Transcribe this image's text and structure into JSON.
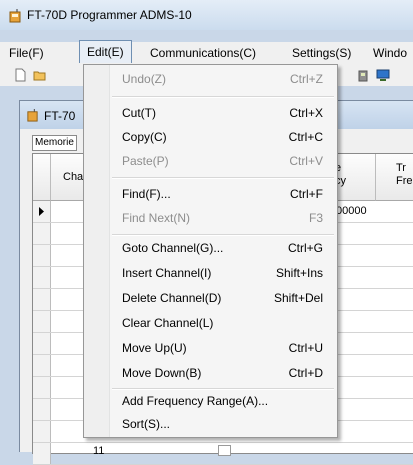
{
  "window": {
    "title": "FT-70D Programmer ADMS-10"
  },
  "menubar": {
    "items": [
      {
        "label": "File(F)"
      },
      {
        "label": "Edit(E)"
      },
      {
        "label": "Communications(C)"
      },
      {
        "label": "Settings(S)"
      },
      {
        "label": "Windo"
      }
    ]
  },
  "child": {
    "title": "FT-70",
    "tab": "Memorie",
    "grid": {
      "headers": [
        "Cha",
        "e\ncy",
        "Tr\nFre"
      ],
      "first_value": "00000",
      "last_row_number": "11"
    }
  },
  "edit_menu": {
    "items": [
      {
        "label": "Undo(Z)",
        "shortcut": "Ctrl+Z",
        "enabled": false
      },
      {
        "label": "Cut(T)",
        "shortcut": "Ctrl+X",
        "enabled": true
      },
      {
        "label": "Copy(C)",
        "shortcut": "Ctrl+C",
        "enabled": true
      },
      {
        "label": "Paste(P)",
        "shortcut": "Ctrl+V",
        "enabled": false
      },
      {
        "label": "Find(F)...",
        "shortcut": "Ctrl+F",
        "enabled": true
      },
      {
        "label": "Find Next(N)",
        "shortcut": "F3",
        "enabled": false
      },
      {
        "label": "Goto Channel(G)...",
        "shortcut": "Ctrl+G",
        "enabled": true
      },
      {
        "label": "Insert Channel(I)",
        "shortcut": "Shift+Ins",
        "enabled": true
      },
      {
        "label": "Delete Channel(D)",
        "shortcut": "Shift+Del",
        "enabled": true
      },
      {
        "label": "Clear Channel(L)",
        "shortcut": "",
        "enabled": true
      },
      {
        "label": "Move Up(U)",
        "shortcut": "Ctrl+U",
        "enabled": true
      },
      {
        "label": "Move Down(B)",
        "shortcut": "Ctrl+D",
        "enabled": true
      },
      {
        "label": "Add Frequency Range(A)...",
        "shortcut": "",
        "enabled": true
      },
      {
        "label": "Sort(S)...",
        "shortcut": "",
        "enabled": true
      }
    ]
  }
}
